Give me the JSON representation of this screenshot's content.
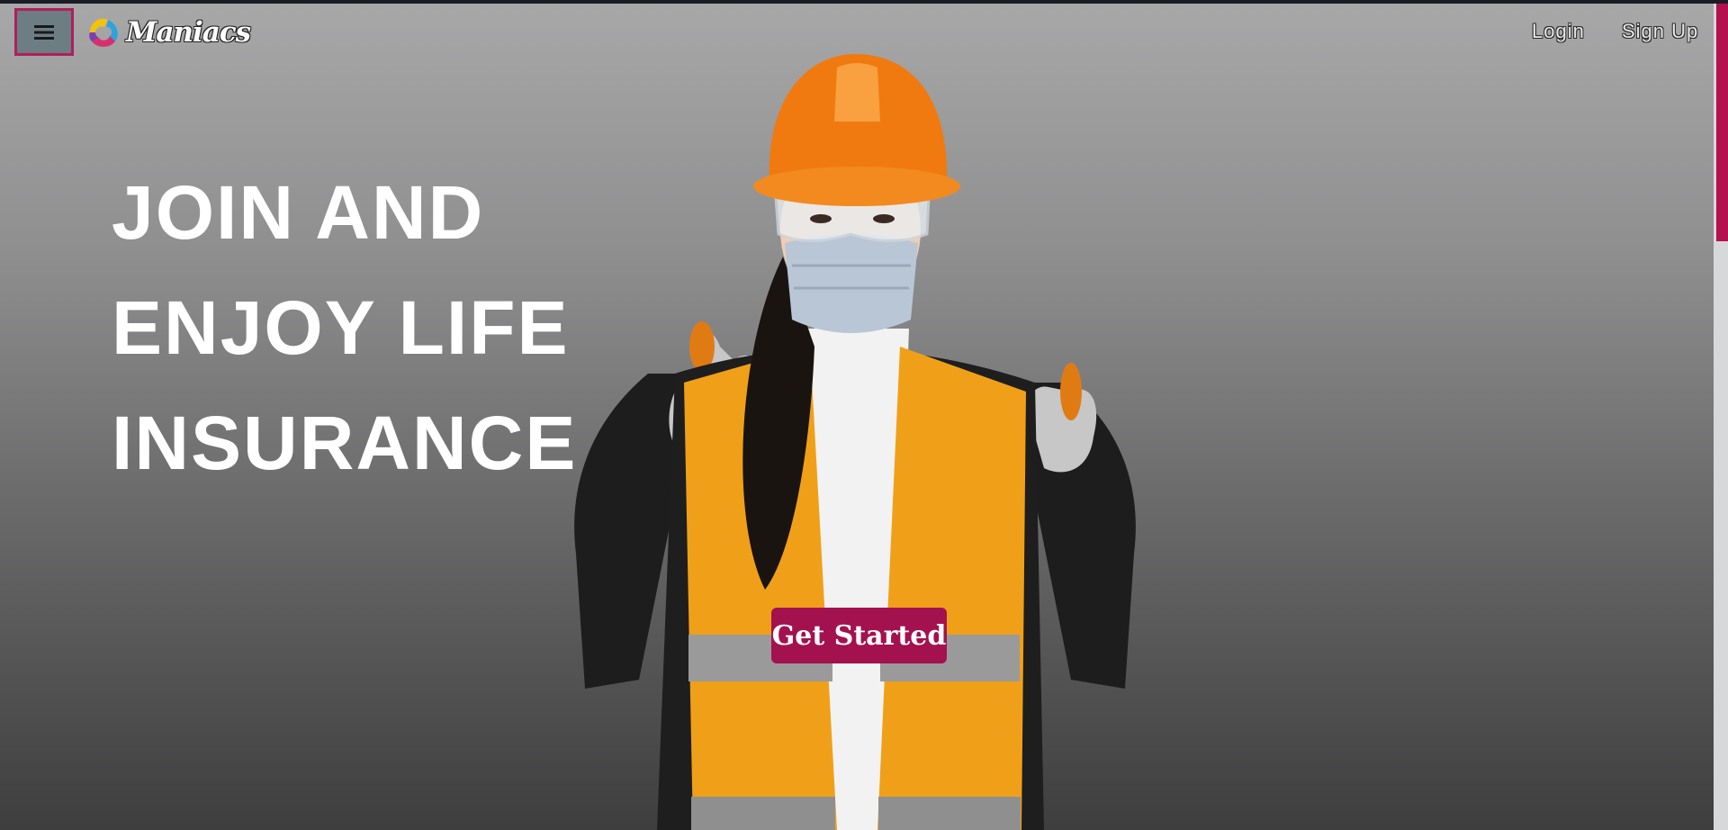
{
  "header": {
    "menu_icon": "hamburger-menu-icon",
    "logo_text": "Maniacs",
    "links": {
      "login": "Login",
      "signup": "Sign Up"
    }
  },
  "hero": {
    "headline_lines": [
      "JOIN AND",
      "ENJOY LIFE",
      "INSURANCE"
    ],
    "cta_label": "Get Started",
    "image_subject": "worker-with-hardhat-thumbs-up"
  },
  "colors": {
    "accent": "#a4114f",
    "menu_button_bg": "#6d7d84",
    "scroll_thumb": "#b4124f"
  }
}
